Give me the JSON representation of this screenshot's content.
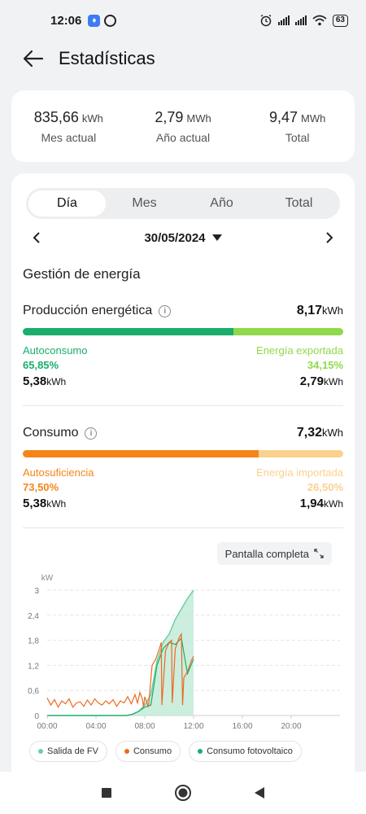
{
  "status_bar": {
    "time": "12:06",
    "battery": "63"
  },
  "header": {
    "title": "Estadísticas"
  },
  "summary": [
    {
      "value": "835,66",
      "unit": "kWh",
      "label": "Mes actual"
    },
    {
      "value": "2,79",
      "unit": "MWh",
      "label": "Año actual"
    },
    {
      "value": "9,47",
      "unit": "MWh",
      "label": "Total"
    }
  ],
  "tabs": [
    {
      "label": "Día",
      "active": true
    },
    {
      "label": "Mes",
      "active": false
    },
    {
      "label": "Año",
      "active": false
    },
    {
      "label": "Total",
      "active": false
    }
  ],
  "date": "30/05/2024",
  "section_title": "Gestión de energía",
  "production": {
    "label": "Producción energética",
    "value": "8,17",
    "unit": "kWh",
    "bar_fraction": 0.6585,
    "left": {
      "name": "Autoconsumo",
      "pct": "65,85%",
      "value": "5,38",
      "unit": "kWh"
    },
    "right": {
      "name": "Energía exportada",
      "pct": "34,15%",
      "value": "2,79",
      "unit": "kWh"
    }
  },
  "consumption": {
    "label": "Consumo",
    "value": "7,32",
    "unit": "kWh",
    "bar_fraction": 0.735,
    "left": {
      "name": "Autosuficiencia",
      "pct": "73,50%",
      "value": "5,38",
      "unit": "kWh"
    },
    "right": {
      "name": "Energía importada",
      "pct": "26,50%",
      "value": "1,94",
      "unit": "kWh"
    }
  },
  "fullscreen_label": "Pantalla completa",
  "colors": {
    "green_dark": "#1aad6c",
    "green_light": "#8fd94a",
    "orange": "#f58518",
    "orange_light": "#fbd18f",
    "pv_fill": "#bfead6",
    "pv_line": "#6ccfa3",
    "consumo_line": "#ee6a23"
  },
  "legend": [
    {
      "label": "Salida de FV",
      "color": "#6ccfa3"
    },
    {
      "label": "Consumo",
      "color": "#ee6a23"
    },
    {
      "label": "Consumo fotovoltaico",
      "color": "#1aad6c"
    }
  ],
  "chart_data": {
    "type": "line",
    "ylabel": "kW",
    "ylim": [
      0,
      3
    ],
    "yticks": [
      "0",
      "0,6",
      "1,2",
      "1,8",
      "2,4",
      "3"
    ],
    "xlim": [
      0,
      24
    ],
    "xticks": [
      "00:00",
      "04:00",
      "08:00",
      "12:00",
      "16:00",
      "20:00"
    ],
    "series": [
      {
        "name": "Salida de FV",
        "x": [
          0,
          6.5,
          7.0,
          7.5,
          8.0,
          8.5,
          9.0,
          9.5,
          10.0,
          10.5,
          11.0,
          11.5,
          12.0
        ],
        "y": [
          0,
          0,
          0.03,
          0.1,
          0.25,
          0.5,
          1.3,
          1.75,
          1.95,
          2.3,
          2.55,
          2.8,
          3.0
        ]
      },
      {
        "name": "Consumo",
        "x": [
          0,
          0.3,
          0.6,
          0.9,
          1.2,
          1.5,
          1.8,
          2.1,
          2.4,
          2.7,
          3.0,
          3.3,
          3.6,
          3.9,
          4.2,
          4.5,
          4.8,
          5.1,
          5.4,
          5.7,
          6.0,
          6.3,
          6.6,
          6.9,
          7.2,
          7.4,
          7.6,
          7.8,
          7.9,
          8.0,
          8.3,
          8.6,
          8.9,
          9.2,
          9.35,
          9.4,
          9.7,
          10.0,
          10.2,
          10.25,
          10.5,
          10.8,
          11.0,
          11.1,
          11.2,
          11.5,
          11.8,
          12.0
        ],
        "y": [
          0.42,
          0.25,
          0.38,
          0.2,
          0.35,
          0.28,
          0.4,
          0.2,
          0.3,
          0.33,
          0.22,
          0.37,
          0.25,
          0.4,
          0.3,
          0.25,
          0.35,
          0.28,
          0.38,
          0.22,
          0.35,
          0.3,
          0.45,
          0.28,
          0.5,
          0.3,
          0.55,
          0.4,
          0.2,
          0.45,
          0.2,
          1.2,
          1.35,
          1.6,
          1.75,
          0.25,
          1.55,
          1.75,
          1.8,
          0.3,
          1.6,
          1.85,
          1.95,
          0.25,
          0.9,
          1.05,
          1.3,
          1.42
        ]
      },
      {
        "name": "Consumo fotovoltaico",
        "x": [
          0,
          6.5,
          7.0,
          7.5,
          8.0,
          8.5,
          9.0,
          9.5,
          10.0,
          10.5,
          11.0,
          11.5,
          12.0
        ],
        "y": [
          0,
          0,
          0.03,
          0.1,
          0.2,
          0.25,
          1.2,
          1.6,
          1.75,
          1.7,
          1.85,
          1.0,
          1.35
        ]
      }
    ]
  }
}
